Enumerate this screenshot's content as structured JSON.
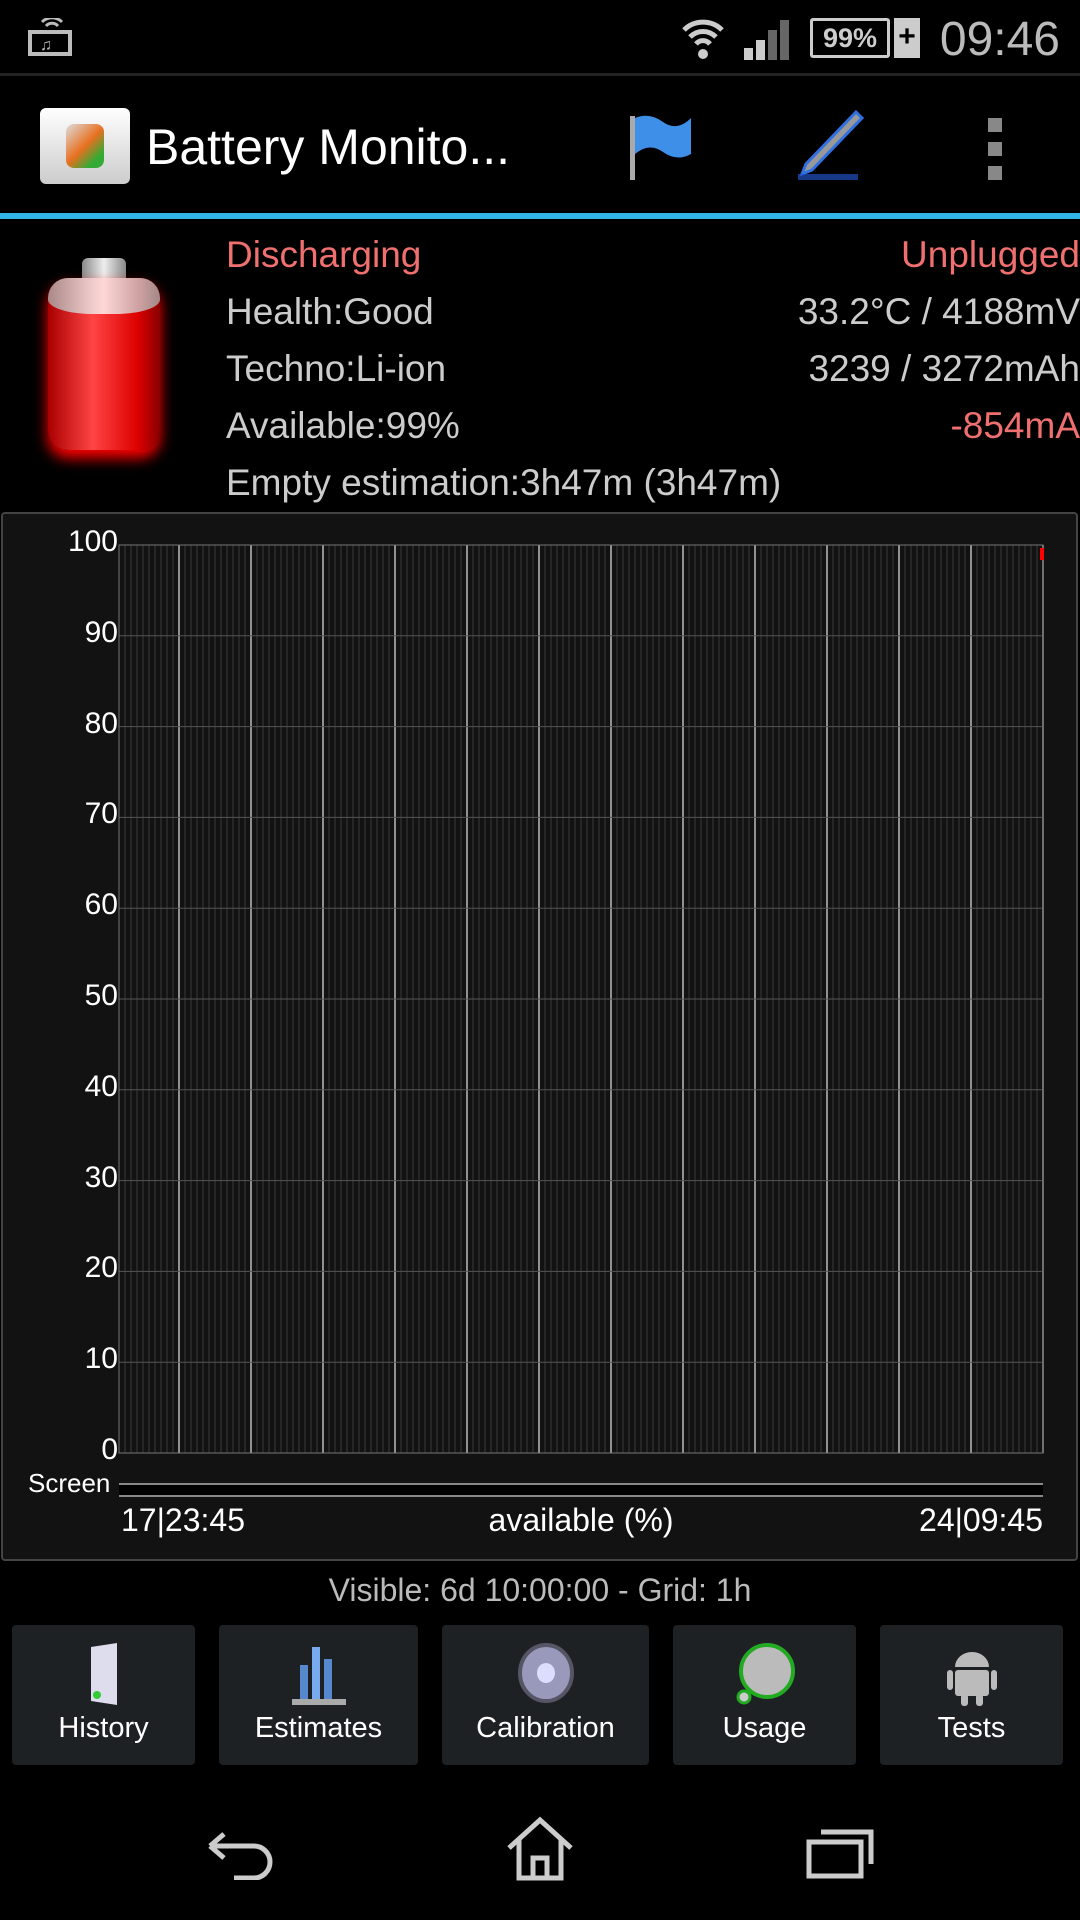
{
  "status_bar": {
    "time": "09:46",
    "battery_level": "99%",
    "icons": [
      "media-notification-icon",
      "wifi-icon",
      "signal-icon",
      "battery-charging-icon"
    ]
  },
  "action_bar": {
    "title": "Battery Monito...",
    "actions": [
      "flag-icon",
      "pencil-icon",
      "overflow-menu-icon"
    ]
  },
  "info": {
    "state": "Discharging",
    "plug": "Unplugged",
    "health": "Health:Good",
    "temp_voltage": "33.2°C / 4188mV",
    "techno": "Techno:Li-ion",
    "capacity": "3239 / 3272mAh",
    "available": "Available:99%",
    "current": "-854mA",
    "estimation": "Empty estimation:3h47m (3h47m)"
  },
  "colors": {
    "accent": "#33b5e5",
    "alert": "#f07070",
    "data_line": "#ff0000"
  },
  "chart_data": {
    "type": "line",
    "xlabel": "available (%)",
    "x_start": "17|23:45",
    "x_end": "24|09:45",
    "ylim": [
      0,
      100
    ],
    "yticks": [
      "0",
      "10",
      "20",
      "30",
      "40",
      "50",
      "60",
      "70",
      "80",
      "90",
      "100"
    ],
    "grid": true,
    "grid_interval": "1h",
    "series": [
      {
        "points": [
          {
            "x": "24|09:45",
            "y": 99
          }
        ]
      }
    ],
    "screen_strip_label": "Screen"
  },
  "footer": {
    "visible": "Visible: 6d 10:00:00 - Grid: 1h"
  },
  "buttons": [
    {
      "label": "History",
      "icon": "history-door-icon"
    },
    {
      "label": "Estimates",
      "icon": "estimates-chart-icon"
    },
    {
      "label": "Calibration",
      "icon": "calibration-disc-icon"
    },
    {
      "label": "Usage",
      "icon": "usage-gauge-icon"
    },
    {
      "label": "Tests",
      "icon": "android-icon"
    }
  ],
  "nav": [
    "back-icon",
    "home-icon",
    "recent-apps-icon"
  ]
}
